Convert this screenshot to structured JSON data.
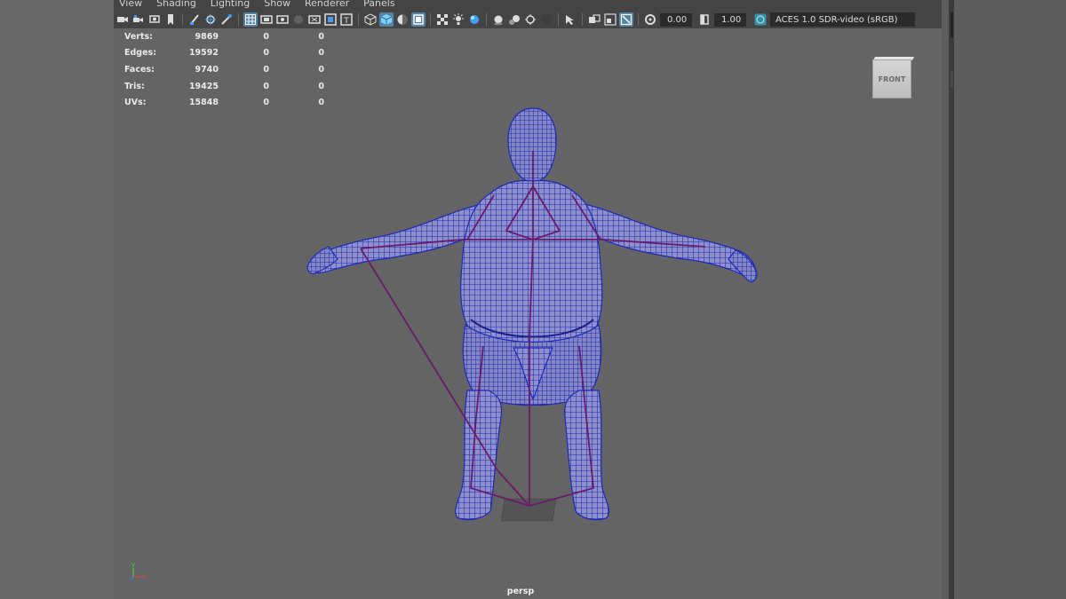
{
  "menu": [
    "View",
    "Shading",
    "Lighting",
    "Show",
    "Renderer",
    "Panels"
  ],
  "toolbar": {
    "icons": [
      "camera-select-icon",
      "camera-attributes-icon",
      "bookmark-icon",
      "image-plane-icon",
      "sep",
      "grease-pencil-icon",
      "2d-pan-zoom-icon",
      "film-gate-icon",
      "sep",
      "grid-icon",
      "resolution-gate-icon",
      "gate-mask-icon",
      "field-chart-icon",
      "safe-action-icon",
      "safe-title-icon",
      "sep",
      "wireframe-icon",
      "smooth-shade-icon",
      "wireframe-on-shaded-icon",
      "textured-icon",
      "use-all-lights-icon",
      "shadows-icon",
      "sep",
      "screen-space-ao-icon",
      "motion-blur-icon",
      "multisample-aa-icon",
      "depth-of-field-icon",
      "sep",
      "isolate-select-icon",
      "xray-icon",
      "xray-active-icon",
      "xray-joints-icon",
      "sep",
      "exposure-icon"
    ],
    "exposure": "0.00",
    "gamma": "1.00",
    "color_space": "ACES 1.0 SDR-video (sRGB)"
  },
  "hud": {
    "rows": [
      {
        "label": "Verts:",
        "v": "9869",
        "a": "0",
        "b": "0"
      },
      {
        "label": "Edges:",
        "v": "19592",
        "a": "0",
        "b": "0"
      },
      {
        "label": "Faces:",
        "v": "9740",
        "a": "0",
        "b": "0"
      },
      {
        "label": "Tris:",
        "v": "19425",
        "a": "0",
        "b": "0"
      },
      {
        "label": "UVs:",
        "v": "15848",
        "a": "0",
        "b": "0"
      }
    ]
  },
  "view_cube": {
    "face": "FRONT"
  },
  "axis": {
    "x": "x",
    "y": "y",
    "x_color": "#e04040",
    "y_color": "#40d040",
    "z_color": "#4070ff"
  },
  "camera": "persp",
  "colors": {
    "wire": "#1c2ab8",
    "bones": "#6a1b6a",
    "viewport": "#646464"
  }
}
